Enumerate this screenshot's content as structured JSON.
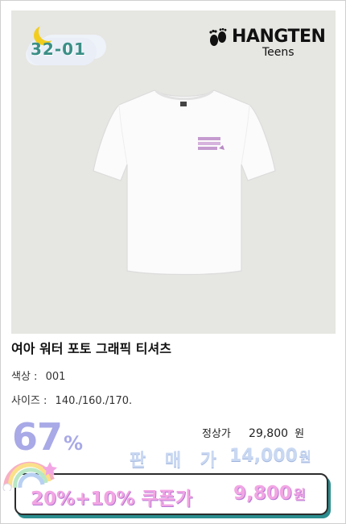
{
  "badge": {
    "code": "32-01"
  },
  "brand": {
    "name": "HANGTEN",
    "sub": "Teens"
  },
  "product": {
    "title": "여아 워터 포토 그래픽 티셔츠",
    "color_label": "색상 :",
    "color_value": "001",
    "size_label": "사이즈 :",
    "size_value": "140./160./170."
  },
  "pricing": {
    "discount": "67",
    "discount_unit": "%",
    "normal_label": "정상가",
    "normal_price": "29,800",
    "currency": "원",
    "sale_label": "판 매 가",
    "sale_price": "14,000",
    "coupon_label": "20%+10% 쿠폰가",
    "coupon_price": "9,800"
  },
  "icons": {
    "moon": "crescent-moon-icon",
    "cloud": "cloud-icon",
    "brand_feet": "footprints-icon",
    "rainbow": "rainbow-icon"
  },
  "colors": {
    "discount": "#a8a9e6",
    "sale": "#c9d8f2",
    "coupon": "#f2a5e3",
    "coupon_border": "#2c2c2c",
    "coupon_shadow": "#2c8d8f"
  }
}
